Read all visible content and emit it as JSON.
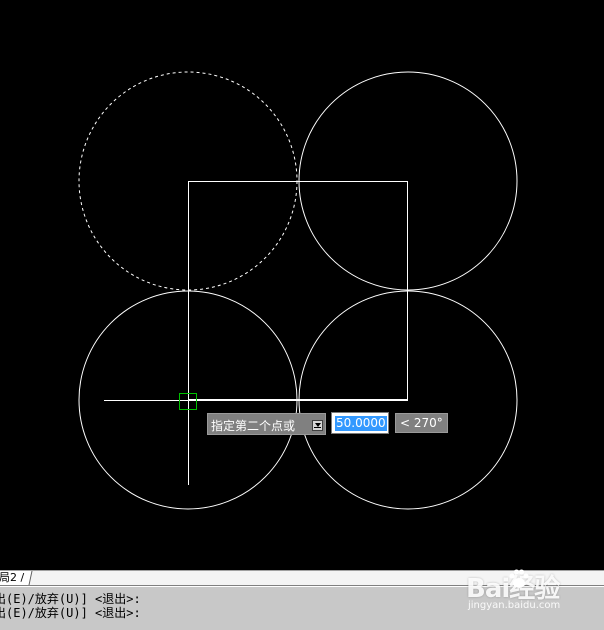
{
  "dynamic_input": {
    "prompt": "指定第二个点或",
    "length_value": "50.0000",
    "angle_value": "< 270°"
  },
  "layout_tabs": [
    {
      "label": "局2 /"
    }
  ],
  "command_history": [
    "出(E)/放弃(U)] <退出>:",
    "出(E)/放弃(U)] <退出>:"
  ],
  "watermark": {
    "logo": "Bai经验",
    "url": "jingyan.baidu.com"
  },
  "colors": {
    "background": "#000000",
    "geometry": "#ffffff",
    "pickbox": "#00c000",
    "selection_highlight": "#3399ff",
    "command_background": "#c8c8c8"
  },
  "icons": {
    "dynamic_input_dropdown": "down-arrow-icon",
    "crosshair": "crosshair-cursor",
    "pickbox": "pickbox-square"
  }
}
